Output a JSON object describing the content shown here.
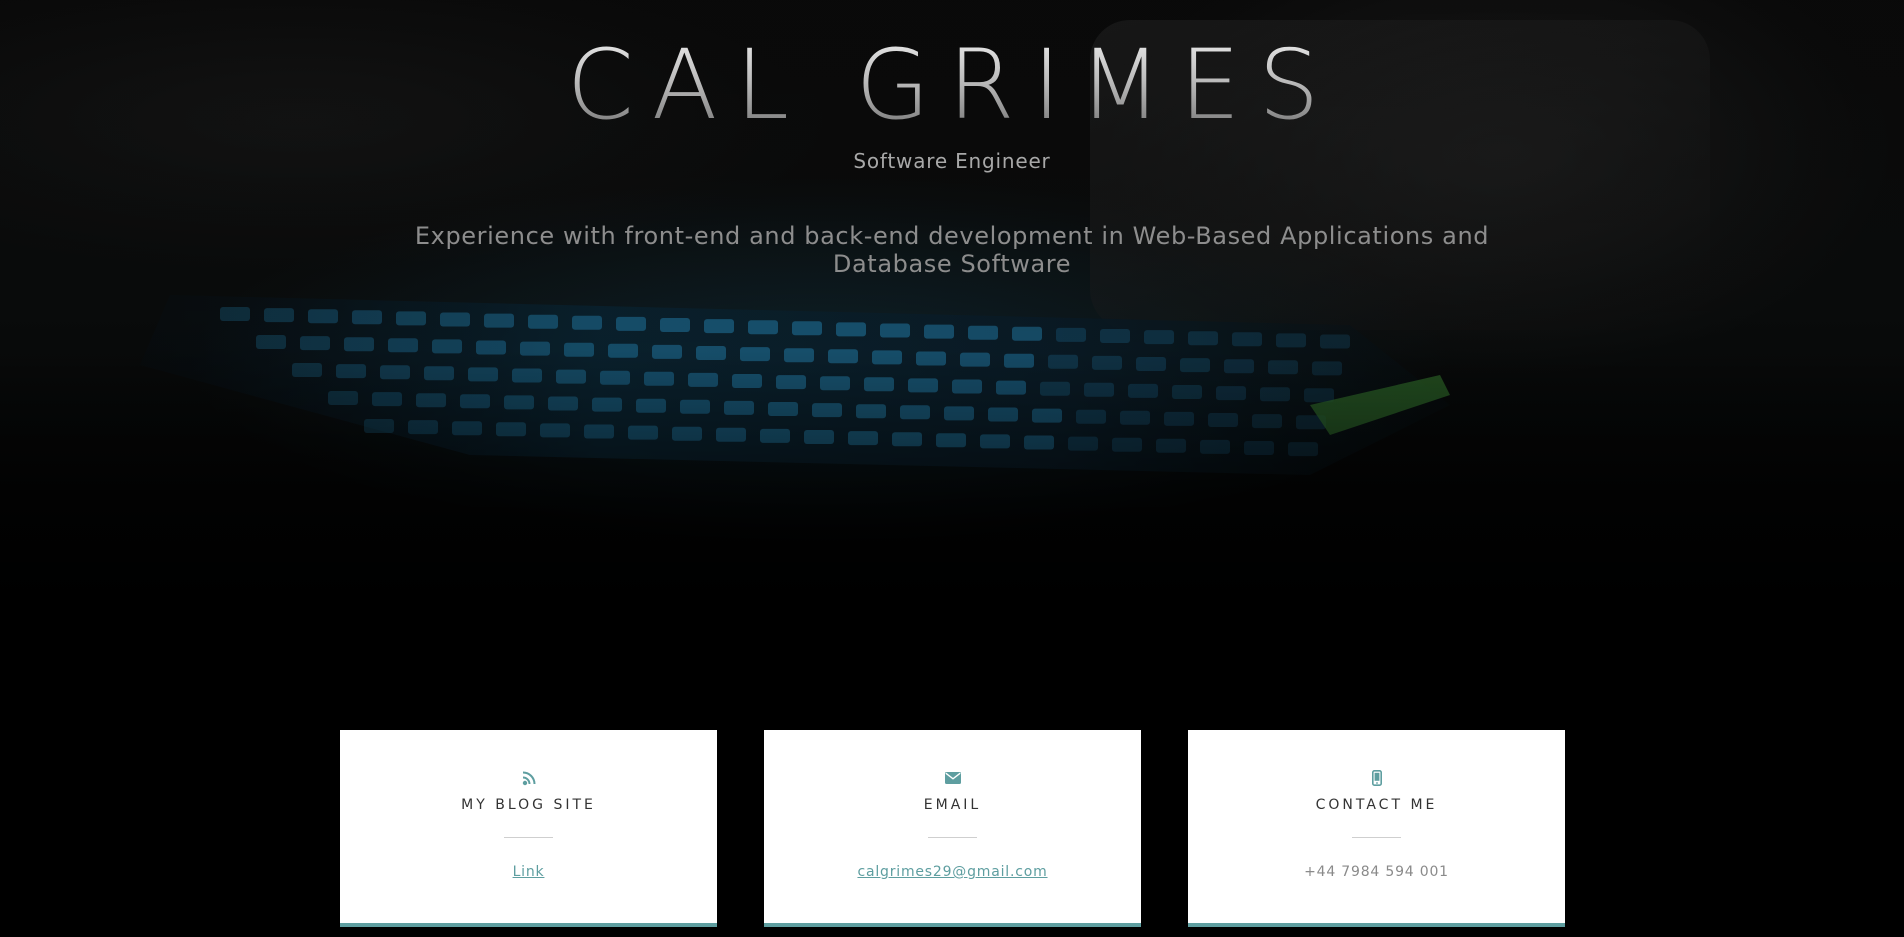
{
  "hero": {
    "title": "CAL GRIMES",
    "subtitle": "Software Engineer",
    "description": "Experience with front-end and back-end development in Web-Based Applications and Database Software"
  },
  "cards": [
    {
      "icon": "rss-icon",
      "title": "MY BLOG SITE",
      "value": "Link"
    },
    {
      "icon": "envelope-icon",
      "title": "EMAIL",
      "value": "calgrimes29@gmail.com"
    },
    {
      "icon": "mobile-phone-icon",
      "title": "CONTACT ME",
      "value": "+44 7984 594 001"
    }
  ],
  "colors": {
    "accent": "#5e9ea0",
    "background": "#000000",
    "card_background": "#ffffff"
  }
}
